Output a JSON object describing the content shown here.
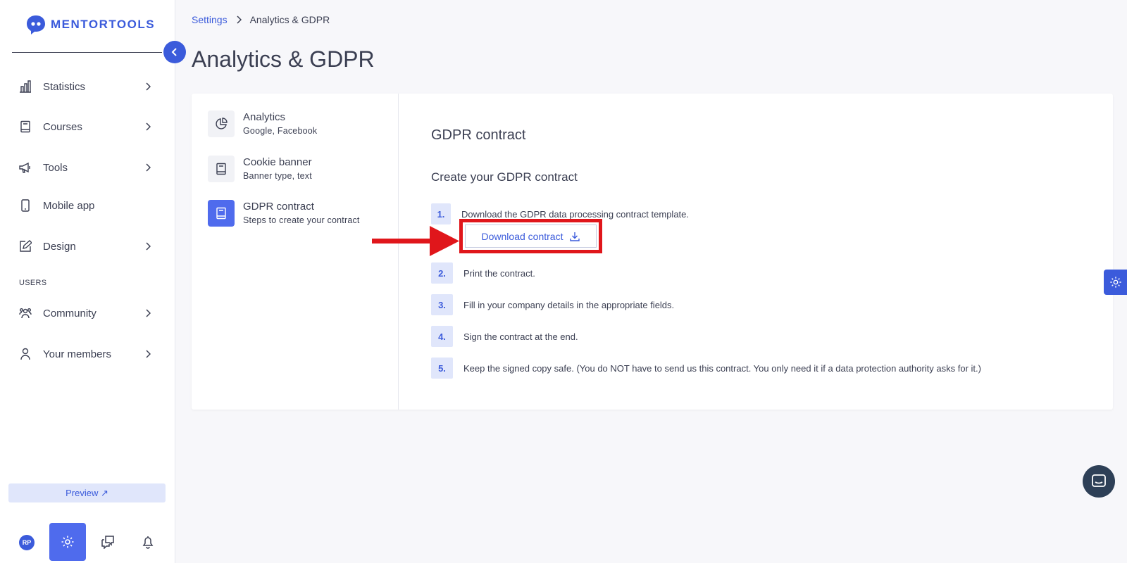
{
  "brand": {
    "name": "MENTORTOOLS"
  },
  "sidebar": {
    "items": [
      {
        "label": "Statistics",
        "icon": "bar-chart-icon"
      },
      {
        "label": "Courses",
        "icon": "book-icon"
      },
      {
        "label": "Tools",
        "icon": "megaphone-icon"
      },
      {
        "label": "Mobile app",
        "icon": "phone-icon"
      },
      {
        "label": "Design",
        "icon": "pencil-icon"
      }
    ],
    "section_users": "USERS",
    "user_items": [
      {
        "label": "Community",
        "icon": "people-icon"
      },
      {
        "label": "Your members",
        "icon": "user-icon"
      }
    ],
    "preview_label": "Preview ↗",
    "avatar_initials": "RP"
  },
  "breadcrumb": {
    "parent": "Settings",
    "current": "Analytics & GDPR"
  },
  "page_title": "Analytics & GDPR",
  "settings_menu": [
    {
      "title": "Analytics",
      "subtitle": "Google, Facebook",
      "icon": "pie-chart-icon",
      "active": false
    },
    {
      "title": "Cookie banner",
      "subtitle": "Banner type, text",
      "icon": "book-icon",
      "active": false
    },
    {
      "title": "GDPR contract",
      "subtitle": "Steps to create your contract",
      "icon": "book-icon",
      "active": true
    }
  ],
  "gdpr": {
    "title": "GDPR contract",
    "subtitle": "Create your GDPR contract",
    "download_label": "Download contract",
    "steps": [
      {
        "num": "1.",
        "text": "Download the GDPR data processing contract template."
      },
      {
        "num": "2.",
        "text": "Print the contract."
      },
      {
        "num": "3.",
        "text": "Fill in your company details in the appropriate fields."
      },
      {
        "num": "4.",
        "text": "Sign the contract at the end."
      },
      {
        "num": "5.",
        "text": "Keep the signed copy safe. (You do NOT have to send us this contract. You only need it if a data protection authority asks for it.)"
      }
    ]
  },
  "colors": {
    "accent": "#3b5bdb",
    "highlight": "#e0161b",
    "text": "#3b3f52"
  }
}
